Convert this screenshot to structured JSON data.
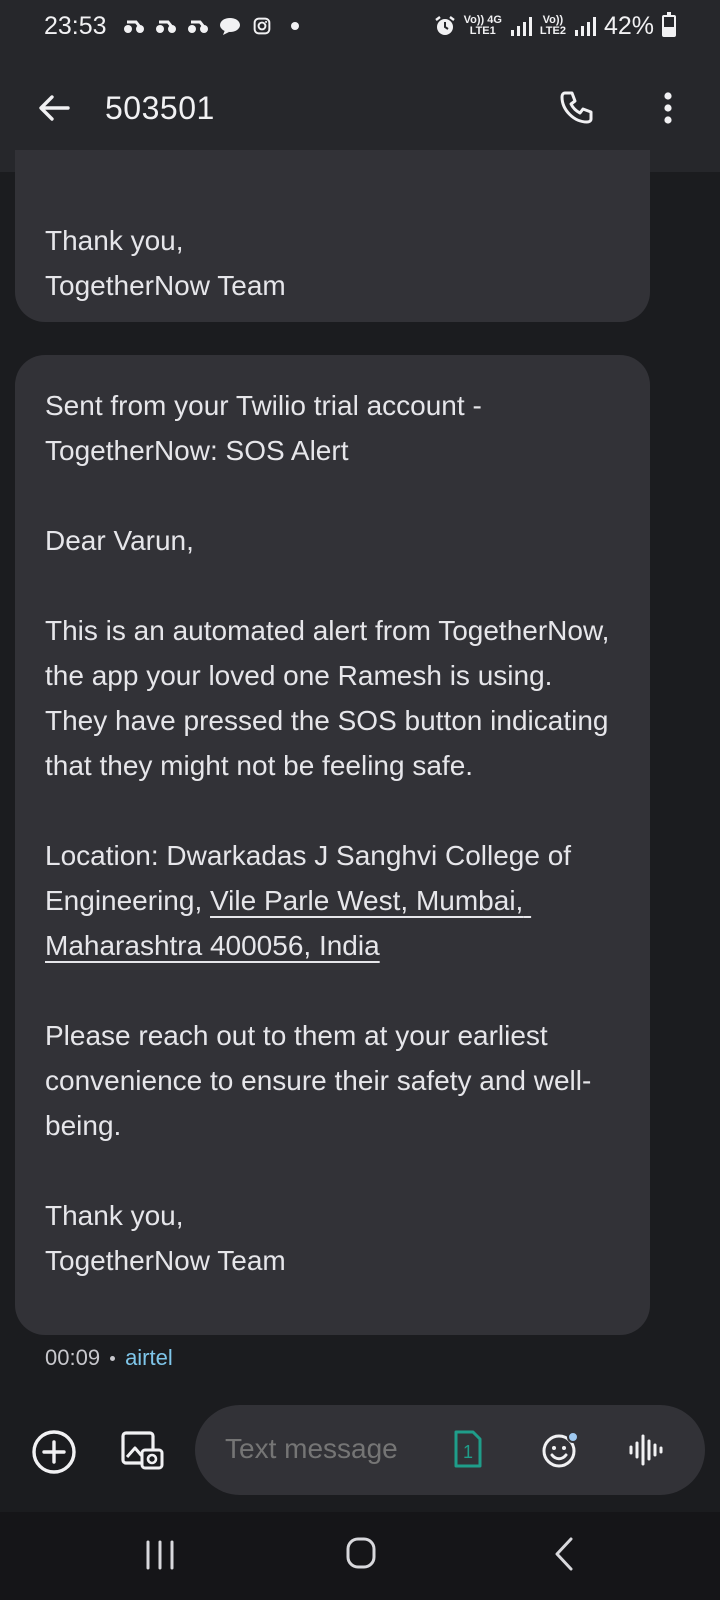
{
  "status_bar": {
    "time": "23:53",
    "net1_top": "Vo)) 4G",
    "net1_bottom": "LTE1",
    "net2_top": "Vo))",
    "net2_bottom": "LTE2",
    "battery": "42%",
    "icons_left": [
      "bike-notification-icon",
      "bike-notification-icon",
      "bike-notification-icon",
      "chat-notification-icon",
      "instagram-icon"
    ],
    "icons_right": [
      "alarm-icon",
      "signal-icon",
      "signal-icon",
      "battery-icon"
    ]
  },
  "app_bar": {
    "title": "503501"
  },
  "messages": [
    {
      "text": "Thank you,\nTogetherNow Team"
    },
    {
      "intro": "Sent from your Twilio trial account - TogetherNow: SOS Alert\n\nDear Varun,\n\nThis is an automated alert from TogetherNow, the app your loved one Ramesh is using. They have pressed the SOS button indicating that they might not be feeling safe.\n\nLocation: Dwarkadas J Sanghvi College of Engineering, ",
      "link": "Vile Parle West, Mumbai, Maharashtra 400056, India",
      "outro": "\n\nPlease reach out to them at your earliest convenience to ensure their safety and well-being.\n\nThank you,\nTogetherNow Team",
      "time": "00:09",
      "carrier": "airtel"
    }
  ],
  "composer": {
    "placeholder": "Text message",
    "sim": "1"
  },
  "colors": {
    "background": "#1b1c1f",
    "bar": "#26272b",
    "bubble": "#323237",
    "carrier": "#7fc6ea",
    "sim": "#1f9d8a"
  }
}
